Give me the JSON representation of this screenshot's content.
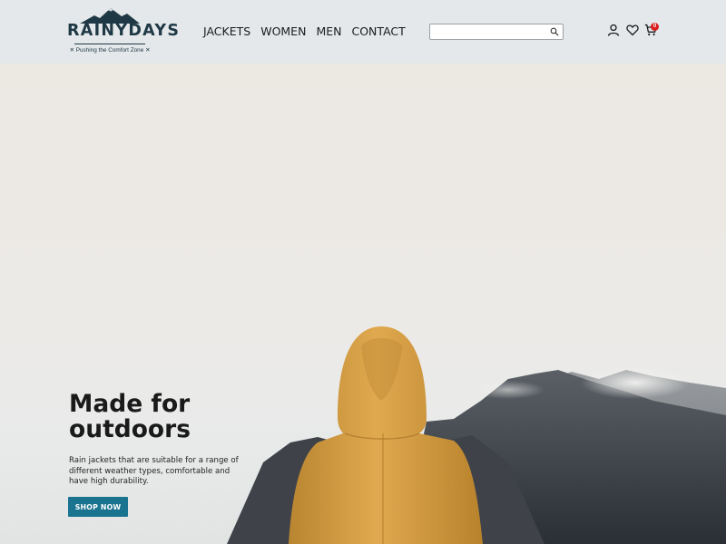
{
  "logo": {
    "name": "RAINYDAYS",
    "tagline": "✕ Pushing the Comfort Zone ✕"
  },
  "nav": {
    "items": [
      {
        "label": "JACKETS"
      },
      {
        "label": "WOMEN"
      },
      {
        "label": "MEN"
      },
      {
        "label": "CONTACT"
      }
    ]
  },
  "search": {
    "value": "",
    "placeholder": "",
    "icon": "search-icon"
  },
  "header_icons": {
    "account": "user-icon",
    "wishlist": "heart-icon",
    "cart": "cart-icon",
    "cart_count": "0"
  },
  "hero": {
    "title": "Made for outdoors",
    "text": "Rain jackets that are suitable for a range of different weather types, comfortable and have high durability.",
    "button_label": "SHOP NOW"
  },
  "colors": {
    "header_bg": "#e4e8ea",
    "brand_navy": "#1f3845",
    "button_teal": "#1a7490",
    "jacket_yellow": "#d9a24a",
    "badge_red": "#d81e1e"
  }
}
